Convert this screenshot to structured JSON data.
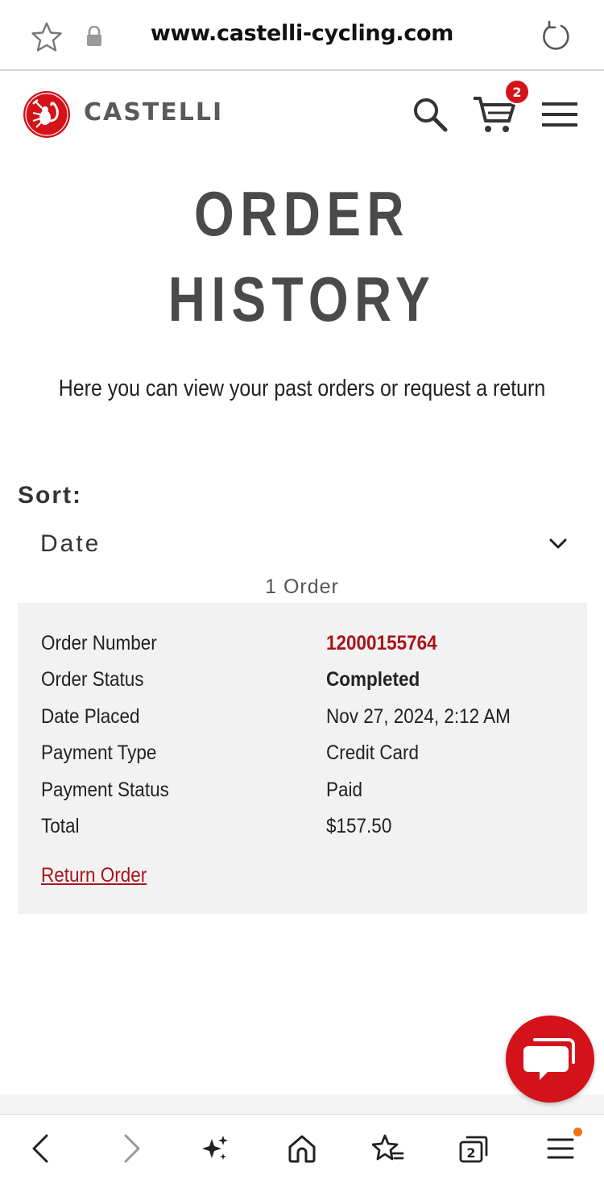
{
  "browser": {
    "url": "www.castelli-cycling.com",
    "icons": [
      "star-icon",
      "lock-icon",
      "reload-icon"
    ]
  },
  "header": {
    "brand": "CASTELLI",
    "cart_count": "2",
    "icons": [
      "scorpion-logo-icon",
      "search-icon",
      "cart-icon",
      "menu-icon"
    ],
    "brand_color": "#d4121a"
  },
  "page": {
    "title_line1": "ORDER",
    "title_line2": "HISTORY",
    "subtitle": "Here you can view your past orders or request a return"
  },
  "sort": {
    "label": "Sort:",
    "selected": "Date"
  },
  "order_count": "1 Order",
  "order": {
    "rows": [
      {
        "label": "Order Number",
        "value": "12000155764"
      },
      {
        "label": "Order Status",
        "value": "Completed"
      },
      {
        "label": "Date Placed",
        "value": "Nov 27, 2024, 2:12 AM"
      },
      {
        "label": "Payment Type",
        "value": "Credit Card"
      },
      {
        "label": "Payment Status",
        "value": "Paid"
      },
      {
        "label": "Total",
        "value": "$157.50"
      }
    ],
    "return_link": "Return Order"
  },
  "bottom_nav": {
    "tab_count": "2",
    "icons": [
      "back-icon",
      "forward-icon",
      "sparkle-icon",
      "home-icon",
      "bookmarks-icon",
      "tabs-icon",
      "menu-icon"
    ]
  },
  "colors": {
    "accent_red": "#a8141b",
    "card_bg": "#f2f2f2",
    "notification_dot": "#f07415"
  }
}
